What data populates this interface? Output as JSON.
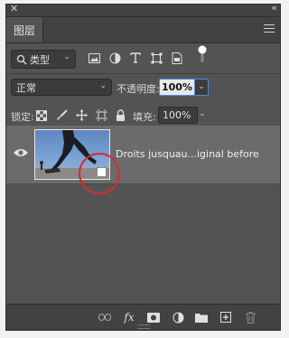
{
  "window": {
    "close_glyph": "✕",
    "collapse_glyph": "«"
  },
  "tab": {
    "label": "图层"
  },
  "filter": {
    "kind_label": "类型"
  },
  "blend": {
    "mode": "正常",
    "opacity_label": "不透明度:",
    "opacity_value": "100%"
  },
  "lock": {
    "label": "锁定:",
    "fill_label": "填充:",
    "fill_value": "100%"
  },
  "layers": [
    {
      "name": "Droits jusquau...iginal before",
      "visible": true,
      "smart_object": true
    }
  ],
  "footer": {
    "fx_label": "fx"
  },
  "colors": {
    "panel": "#535353",
    "selected_row": "#6b6b6b",
    "accent_focus": "#4a8be0",
    "highlight_circle": "#d92b2b"
  }
}
